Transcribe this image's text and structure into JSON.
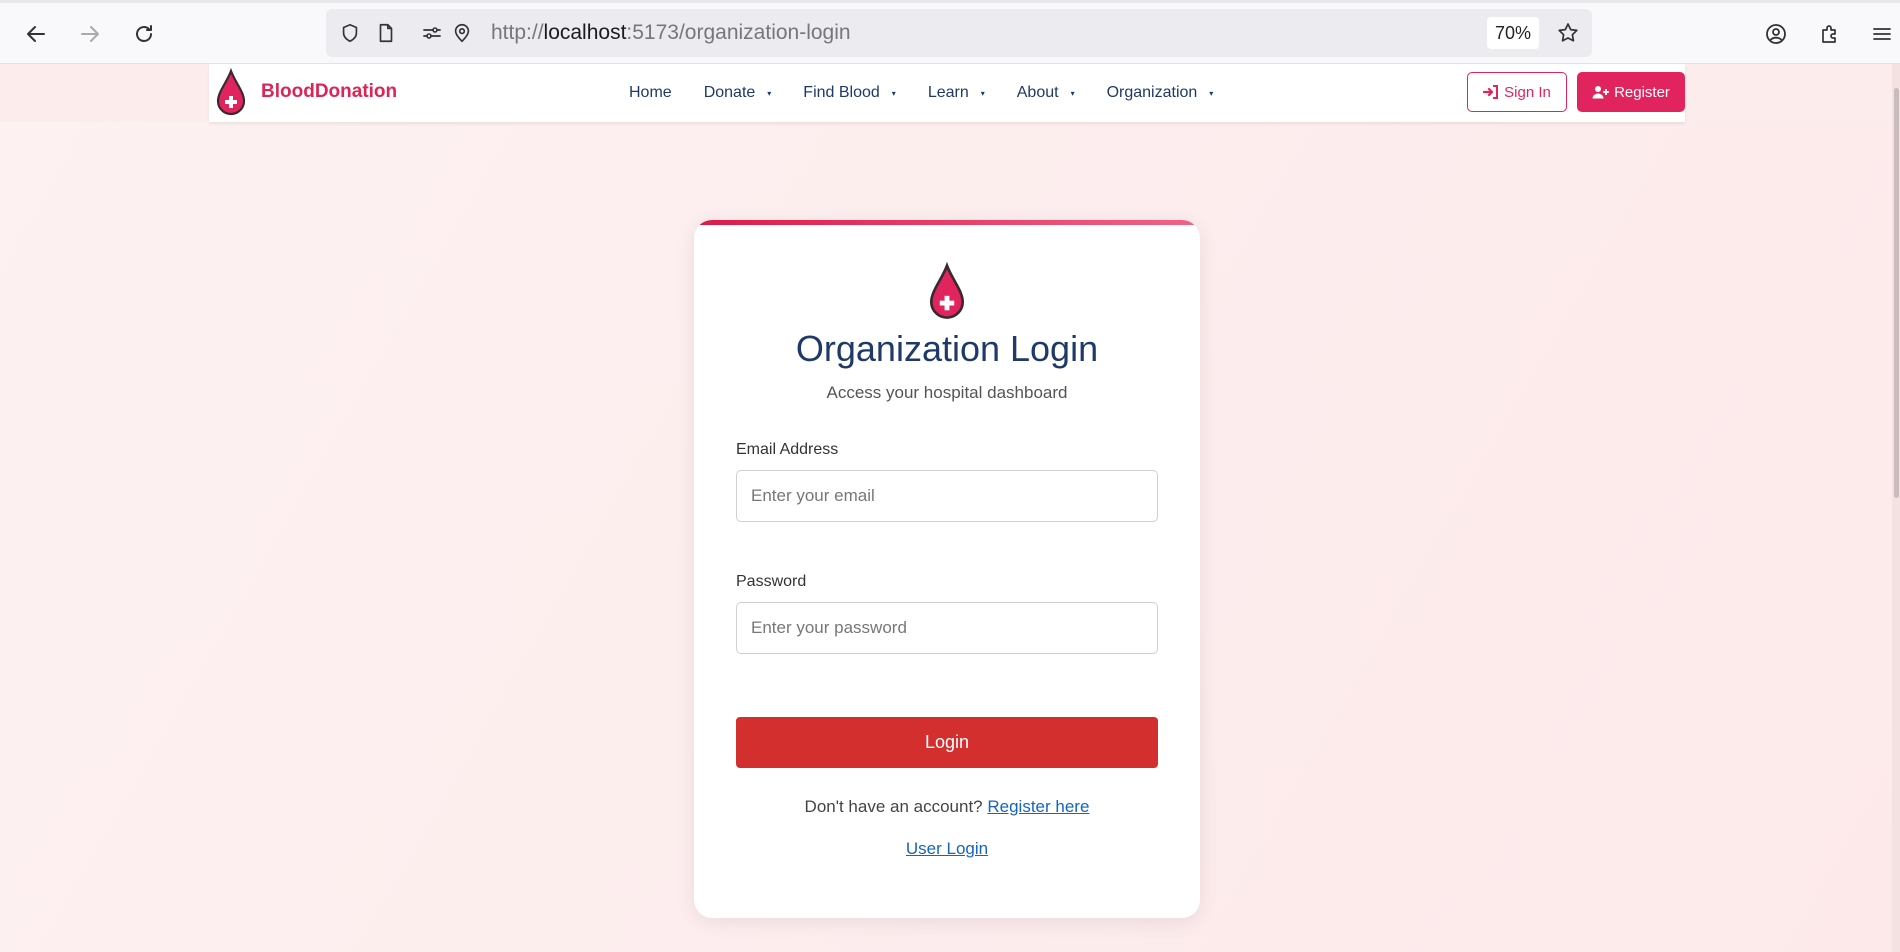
{
  "browser": {
    "url_prefix": "http://",
    "url_host": "localhost",
    "url_path": ":5173/organization-login",
    "zoom": "70%"
  },
  "header": {
    "brand": "BloodDonation",
    "menu": [
      {
        "label": "Home",
        "has_dropdown": false
      },
      {
        "label": "Donate",
        "has_dropdown": true
      },
      {
        "label": "Find Blood",
        "has_dropdown": true
      },
      {
        "label": "Learn",
        "has_dropdown": true
      },
      {
        "label": "About",
        "has_dropdown": true
      },
      {
        "label": "Organization",
        "has_dropdown": true
      }
    ],
    "caret": "▾",
    "signin_label": "Sign In",
    "register_label": "Register"
  },
  "login": {
    "title": "Organization Login",
    "subtitle": "Access your hospital dashboard",
    "email_label": "Email Address",
    "email_placeholder": "Enter your email",
    "email_value": "",
    "password_label": "Password",
    "password_placeholder": "Enter your password",
    "password_value": "",
    "submit_label": "Login",
    "no_account_text": "Don't have an account?",
    "register_link": "Register here",
    "user_login_link": "User Login"
  },
  "colors": {
    "brand": "#dc2456",
    "primary_button": "#d32f2f",
    "nav_text": "#1f3a68",
    "link": "#1565c0"
  }
}
